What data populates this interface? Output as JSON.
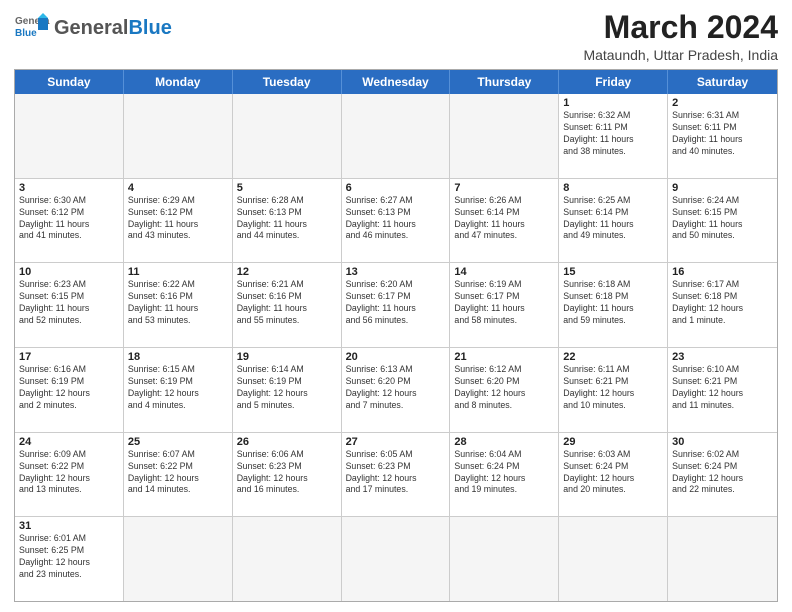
{
  "header": {
    "logo_general": "General",
    "logo_blue": "Blue",
    "month_title": "March 2024",
    "location": "Mataundh, Uttar Pradesh, India"
  },
  "days_of_week": [
    "Sunday",
    "Monday",
    "Tuesday",
    "Wednesday",
    "Thursday",
    "Friday",
    "Saturday"
  ],
  "weeks": [
    [
      {
        "day": "",
        "empty": true
      },
      {
        "day": "",
        "empty": true
      },
      {
        "day": "",
        "empty": true
      },
      {
        "day": "",
        "empty": true
      },
      {
        "day": "",
        "empty": true
      },
      {
        "day": "1",
        "info": "Sunrise: 6:32 AM\nSunset: 6:11 PM\nDaylight: 11 hours\nand 38 minutes."
      },
      {
        "day": "2",
        "info": "Sunrise: 6:31 AM\nSunset: 6:11 PM\nDaylight: 11 hours\nand 40 minutes."
      }
    ],
    [
      {
        "day": "3",
        "info": "Sunrise: 6:30 AM\nSunset: 6:12 PM\nDaylight: 11 hours\nand 41 minutes."
      },
      {
        "day": "4",
        "info": "Sunrise: 6:29 AM\nSunset: 6:12 PM\nDaylight: 11 hours\nand 43 minutes."
      },
      {
        "day": "5",
        "info": "Sunrise: 6:28 AM\nSunset: 6:13 PM\nDaylight: 11 hours\nand 44 minutes."
      },
      {
        "day": "6",
        "info": "Sunrise: 6:27 AM\nSunset: 6:13 PM\nDaylight: 11 hours\nand 46 minutes."
      },
      {
        "day": "7",
        "info": "Sunrise: 6:26 AM\nSunset: 6:14 PM\nDaylight: 11 hours\nand 47 minutes."
      },
      {
        "day": "8",
        "info": "Sunrise: 6:25 AM\nSunset: 6:14 PM\nDaylight: 11 hours\nand 49 minutes."
      },
      {
        "day": "9",
        "info": "Sunrise: 6:24 AM\nSunset: 6:15 PM\nDaylight: 11 hours\nand 50 minutes."
      }
    ],
    [
      {
        "day": "10",
        "info": "Sunrise: 6:23 AM\nSunset: 6:15 PM\nDaylight: 11 hours\nand 52 minutes."
      },
      {
        "day": "11",
        "info": "Sunrise: 6:22 AM\nSunset: 6:16 PM\nDaylight: 11 hours\nand 53 minutes."
      },
      {
        "day": "12",
        "info": "Sunrise: 6:21 AM\nSunset: 6:16 PM\nDaylight: 11 hours\nand 55 minutes."
      },
      {
        "day": "13",
        "info": "Sunrise: 6:20 AM\nSunset: 6:17 PM\nDaylight: 11 hours\nand 56 minutes."
      },
      {
        "day": "14",
        "info": "Sunrise: 6:19 AM\nSunset: 6:17 PM\nDaylight: 11 hours\nand 58 minutes."
      },
      {
        "day": "15",
        "info": "Sunrise: 6:18 AM\nSunset: 6:18 PM\nDaylight: 11 hours\nand 59 minutes."
      },
      {
        "day": "16",
        "info": "Sunrise: 6:17 AM\nSunset: 6:18 PM\nDaylight: 12 hours\nand 1 minute."
      }
    ],
    [
      {
        "day": "17",
        "info": "Sunrise: 6:16 AM\nSunset: 6:19 PM\nDaylight: 12 hours\nand 2 minutes."
      },
      {
        "day": "18",
        "info": "Sunrise: 6:15 AM\nSunset: 6:19 PM\nDaylight: 12 hours\nand 4 minutes."
      },
      {
        "day": "19",
        "info": "Sunrise: 6:14 AM\nSunset: 6:19 PM\nDaylight: 12 hours\nand 5 minutes."
      },
      {
        "day": "20",
        "info": "Sunrise: 6:13 AM\nSunset: 6:20 PM\nDaylight: 12 hours\nand 7 minutes."
      },
      {
        "day": "21",
        "info": "Sunrise: 6:12 AM\nSunset: 6:20 PM\nDaylight: 12 hours\nand 8 minutes."
      },
      {
        "day": "22",
        "info": "Sunrise: 6:11 AM\nSunset: 6:21 PM\nDaylight: 12 hours\nand 10 minutes."
      },
      {
        "day": "23",
        "info": "Sunrise: 6:10 AM\nSunset: 6:21 PM\nDaylight: 12 hours\nand 11 minutes."
      }
    ],
    [
      {
        "day": "24",
        "info": "Sunrise: 6:09 AM\nSunset: 6:22 PM\nDaylight: 12 hours\nand 13 minutes."
      },
      {
        "day": "25",
        "info": "Sunrise: 6:07 AM\nSunset: 6:22 PM\nDaylight: 12 hours\nand 14 minutes."
      },
      {
        "day": "26",
        "info": "Sunrise: 6:06 AM\nSunset: 6:23 PM\nDaylight: 12 hours\nand 16 minutes."
      },
      {
        "day": "27",
        "info": "Sunrise: 6:05 AM\nSunset: 6:23 PM\nDaylight: 12 hours\nand 17 minutes."
      },
      {
        "day": "28",
        "info": "Sunrise: 6:04 AM\nSunset: 6:24 PM\nDaylight: 12 hours\nand 19 minutes."
      },
      {
        "day": "29",
        "info": "Sunrise: 6:03 AM\nSunset: 6:24 PM\nDaylight: 12 hours\nand 20 minutes."
      },
      {
        "day": "30",
        "info": "Sunrise: 6:02 AM\nSunset: 6:24 PM\nDaylight: 12 hours\nand 22 minutes."
      }
    ],
    [
      {
        "day": "31",
        "info": "Sunrise: 6:01 AM\nSunset: 6:25 PM\nDaylight: 12 hours\nand 23 minutes."
      },
      {
        "day": "",
        "empty": true
      },
      {
        "day": "",
        "empty": true
      },
      {
        "day": "",
        "empty": true
      },
      {
        "day": "",
        "empty": true
      },
      {
        "day": "",
        "empty": true
      },
      {
        "day": "",
        "empty": true
      }
    ]
  ]
}
